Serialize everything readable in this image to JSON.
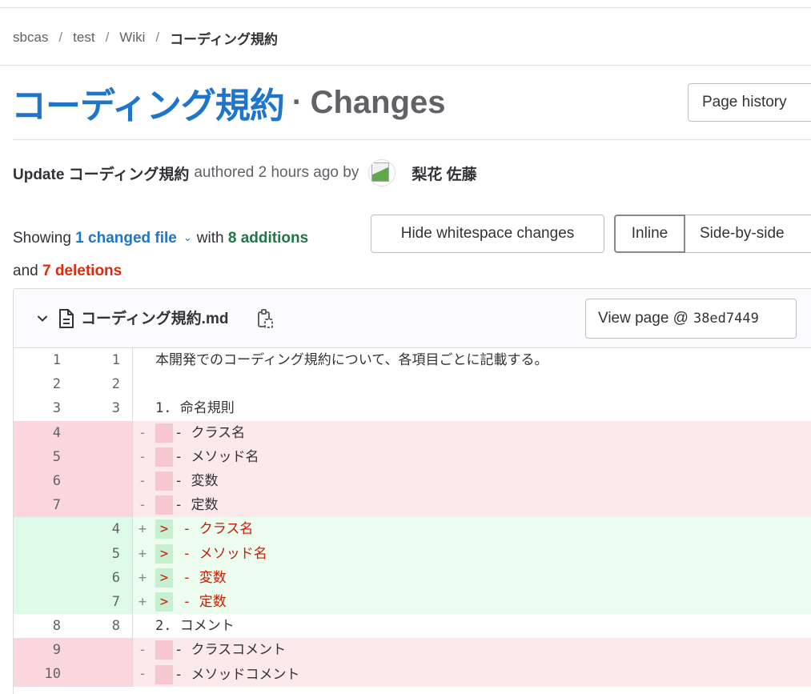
{
  "breadcrumb": {
    "items": [
      "sbcas",
      "test",
      "Wiki"
    ],
    "current": "コーディング規約",
    "separator": "/"
  },
  "title": {
    "wiki_name": "コーディング規約",
    "separator": "·",
    "suffix": "Changes"
  },
  "page_history_label": "Page history",
  "commit": {
    "message": "Update コーディング規約",
    "meta": "authored 2 hours ago by",
    "author": "梨花 佐藤"
  },
  "summary": {
    "showing": "Showing",
    "changed_files": "1 changed file",
    "with": "with",
    "additions": "8 additions",
    "and": "and",
    "deletions": "7 deletions"
  },
  "buttons": {
    "hide_whitespace": "Hide whitespace changes",
    "inline": "Inline",
    "side_by_side": "Side-by-side"
  },
  "file": {
    "name": "コーディング規約.md",
    "view_page_label": "View page @",
    "view_page_sha": "38ed7449"
  },
  "diff_lines": [
    {
      "type": "ctx",
      "old": "1",
      "new": "1",
      "marker": "",
      "highlight": "",
      "text": "本開発でのコーディング規約について、各項目ごとに記載する。"
    },
    {
      "type": "ctx",
      "old": "2",
      "new": "2",
      "marker": "",
      "highlight": "",
      "text": ""
    },
    {
      "type": "ctx",
      "old": "3",
      "new": "3",
      "marker": "",
      "highlight": "",
      "text": "1. 命名規則"
    },
    {
      "type": "del",
      "old": "4",
      "new": "",
      "marker": "-",
      "highlight": "",
      "text": "- クラス名"
    },
    {
      "type": "del",
      "old": "5",
      "new": "",
      "marker": "-",
      "highlight": "",
      "text": "- メソッド名"
    },
    {
      "type": "del",
      "old": "6",
      "new": "",
      "marker": "-",
      "highlight": "",
      "text": "- 変数"
    },
    {
      "type": "del",
      "old": "7",
      "new": "",
      "marker": "-",
      "highlight": "",
      "text": "- 定数"
    },
    {
      "type": "add",
      "old": "",
      "new": "4",
      "marker": "+",
      "highlight": ">",
      "text": " - クラス名"
    },
    {
      "type": "add",
      "old": "",
      "new": "5",
      "marker": "+",
      "highlight": ">",
      "text": " - メソッド名"
    },
    {
      "type": "add",
      "old": "",
      "new": "6",
      "marker": "+",
      "highlight": ">",
      "text": " - 変数"
    },
    {
      "type": "add",
      "old": "",
      "new": "7",
      "marker": "+",
      "highlight": ">",
      "text": " - 定数"
    },
    {
      "type": "ctx",
      "old": "8",
      "new": "8",
      "marker": "",
      "highlight": "",
      "text": "2. コメント"
    },
    {
      "type": "del",
      "old": "9",
      "new": "",
      "marker": "-",
      "highlight": "",
      "text": "- クラスコメント"
    },
    {
      "type": "del",
      "old": "10",
      "new": "",
      "marker": "-",
      "highlight": "",
      "text": "- メソッドコメント"
    }
  ],
  "colors": {
    "link": "#1f75cb",
    "additions": "#217645",
    "deletions": "#dd2b0e",
    "deleted_row": "#fbe9eb",
    "added_row": "#ecfdf0"
  },
  "icons": [
    "chevron-down-icon",
    "file-icon",
    "copy-icon",
    "avatar-image"
  ]
}
